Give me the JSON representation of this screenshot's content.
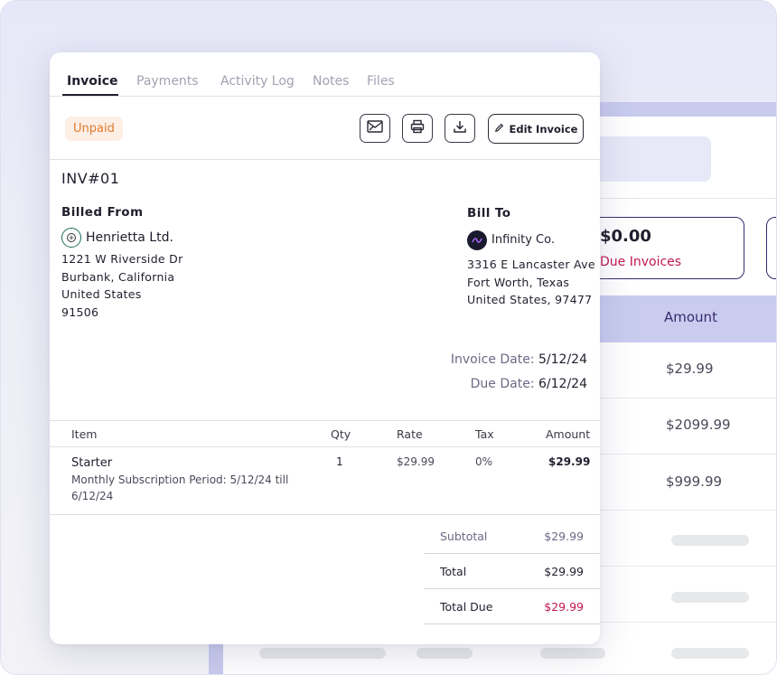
{
  "background": {
    "card_amount": "$0.00",
    "card_label": "Due Invoices",
    "table_header": "Amount",
    "rows": [
      "$29.99",
      "$2099.99",
      "$999.99"
    ]
  },
  "tabs": [
    {
      "label": "Invoice",
      "active": true
    },
    {
      "label": "Payments",
      "active": false
    },
    {
      "label": "Activity Log",
      "active": false
    },
    {
      "label": "Notes",
      "active": false
    },
    {
      "label": "Files",
      "active": false
    }
  ],
  "status_badge": "Unpaid",
  "toolbar": {
    "send_icon": "send-envelope-icon",
    "print_icon": "printer-icon",
    "download_icon": "download-icon",
    "edit_label": "Edit Invoice"
  },
  "invoice": {
    "number": "INV#01",
    "billed_from": {
      "heading": "Billed From",
      "name": "Henrietta Ltd.",
      "address": [
        "1221 W Riverside Dr",
        "Burbank, California",
        "United States",
        "91506"
      ]
    },
    "bill_to": {
      "heading": "Bill To",
      "name": "Infinity Co.",
      "address": [
        "3316 E Lancaster Ave",
        "Fort Worth, Texas",
        "United States, 97477"
      ]
    },
    "invoice_date_label": "Invoice Date:",
    "invoice_date": "5/12/24",
    "due_date_label": "Due Date:",
    "due_date": "6/12/24"
  },
  "items_table": {
    "headers": {
      "item": "Item",
      "qty": "Qty",
      "rate": "Rate",
      "tax": "Tax",
      "amount": "Amount"
    },
    "rows": [
      {
        "name": "Starter",
        "description_line1": "Monthly Subscription Period: 5/12/24 till",
        "description_line2": "6/12/24",
        "qty": "1",
        "rate": "$29.99",
        "tax": "0%",
        "amount": "$29.99"
      }
    ]
  },
  "summary": {
    "subtotal_label": "Subtotal",
    "subtotal": "$29.99",
    "total_label": "Total",
    "total": "$29.99",
    "total_due_label": "Total Due",
    "total_due": "$29.99"
  },
  "colors": {
    "accent": "#3a2a6e",
    "due": "#c0174f",
    "badge_bg": "#fdeee6",
    "badge_text": "#e07b2c"
  }
}
